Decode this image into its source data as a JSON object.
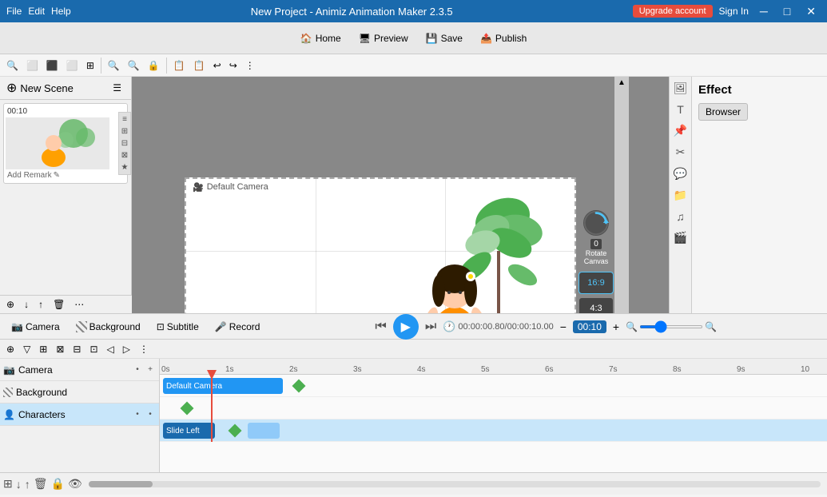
{
  "app": {
    "title": "New Project - Animiz Animation Maker 2.3.5",
    "upgrade_label": "Upgrade account",
    "signin_label": "Sign In"
  },
  "menu": {
    "file": "File",
    "edit": "Edit",
    "help": "Help"
  },
  "toolbar": {
    "home": "Home",
    "preview": "Preview",
    "save": "Save",
    "publish": "Publish"
  },
  "scenes": {
    "new_scene": "New Scene",
    "add_remark": "Add Remark",
    "scene_time": "00:10"
  },
  "canvas": {
    "camera_label": "Default Camera",
    "rotate_label": "Rotate Canvas",
    "rotate_value": "0",
    "ratio_16_9": "16:9",
    "ratio_4_3": "4:3",
    "ratio_custom": "?:?"
  },
  "effect": {
    "title": "Effect",
    "browser_label": "Browser"
  },
  "timeline": {
    "camera_tab": "Camera",
    "background_tab": "Background",
    "subtitle_tab": "Subtitle",
    "record_tab": "Record",
    "time_display": "00:00:00.80/00:00:10.00",
    "time_value": "00:10",
    "tracks": [
      {
        "name": "Camera",
        "type": "camera"
      },
      {
        "name": "Background",
        "type": "bg"
      },
      {
        "name": "Characters",
        "type": "char",
        "selected": true
      }
    ],
    "markers": [
      "0s",
      "1s",
      "2s",
      "3s",
      "4s",
      "5s",
      "6s",
      "7s",
      "8s",
      "9s",
      "10"
    ],
    "camera_block": "Default Camera",
    "characters_block": "Slide Left"
  }
}
